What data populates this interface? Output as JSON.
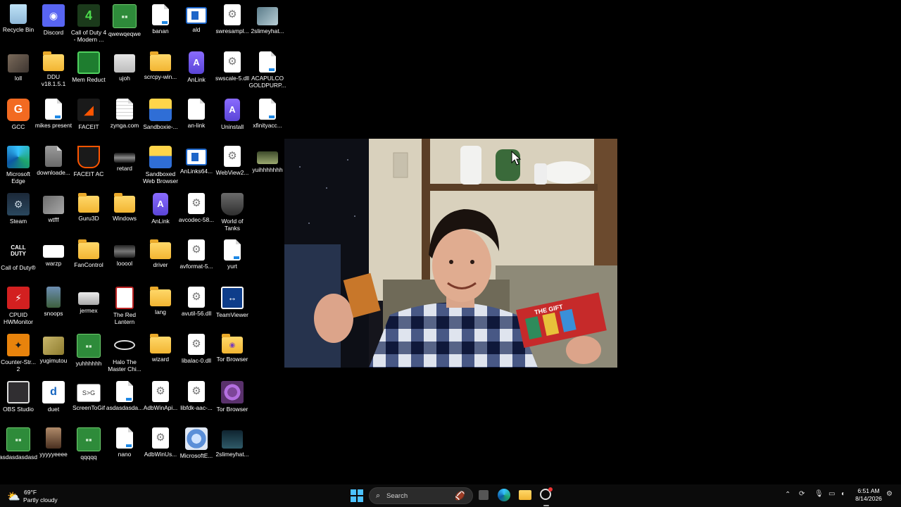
{
  "desktop": {
    "icons": [
      {
        "label": "Recycle Bin",
        "icon": "recycle-bin-icon"
      },
      {
        "label": "Discord",
        "icon": "discord-icon"
      },
      {
        "label": "Call of Duty 4 - Modern ...",
        "icon": "cod4-icon"
      },
      {
        "label": "qwewqeqwe",
        "icon": "creeper-icon"
      },
      {
        "label": "banan",
        "icon": "file-icon"
      },
      {
        "label": "ald",
        "icon": "window-file-icon"
      },
      {
        "label": "swresampl...",
        "icon": "dll-icon"
      },
      {
        "label": "2slimeyhat...",
        "icon": "image-icon"
      },
      {
        "label": "loll",
        "icon": "image-icon"
      },
      {
        "label": "DDU v18.1.5.1",
        "icon": "folder-icon"
      },
      {
        "label": "Mem Reduct",
        "icon": "mem-reduct-icon"
      },
      {
        "label": "ujoh",
        "icon": "image-icon"
      },
      {
        "label": "scrcpy-win...",
        "icon": "folder-icon"
      },
      {
        "label": "AnLink",
        "icon": "anlink-icon"
      },
      {
        "label": "swscale-5.dll",
        "icon": "dll-icon"
      },
      {
        "label": "ACAPULCO GOLDPURP...",
        "icon": "file-icon"
      },
      {
        "label": "GCC",
        "icon": "gcc-icon"
      },
      {
        "label": "mikes present",
        "icon": "file-icon"
      },
      {
        "label": "FACEIT",
        "icon": "faceit-icon"
      },
      {
        "label": "zynga.com",
        "icon": "text-file-icon"
      },
      {
        "label": "Sandboxie-...",
        "icon": "sandboxie-icon"
      },
      {
        "label": "an-link",
        "icon": "file-icon"
      },
      {
        "label": "Uninstall",
        "icon": "uninstall-icon"
      },
      {
        "label": "xfinityacc...",
        "icon": "file-icon"
      },
      {
        "label": "Microsoft Edge",
        "icon": "edge-icon"
      },
      {
        "label": "downloade...",
        "icon": "image-icon"
      },
      {
        "label": "FACEIT AC",
        "icon": "faceit-ac-icon"
      },
      {
        "label": "retard",
        "icon": "image-icon"
      },
      {
        "label": "Sandboxed Web Browser",
        "icon": "sandboxie-icon"
      },
      {
        "label": "AnLinks64...",
        "icon": "window-file-icon"
      },
      {
        "label": "WebView2...",
        "icon": "dll-icon"
      },
      {
        "label": "yuihhhhhhh",
        "icon": "image-icon"
      },
      {
        "label": "Steam",
        "icon": "steam-icon"
      },
      {
        "label": "wtfff",
        "icon": "image-icon"
      },
      {
        "label": "Guru3D",
        "icon": "folder-icon"
      },
      {
        "label": "Windows",
        "icon": "folder-icon"
      },
      {
        "label": "AnLink",
        "icon": "anlink-icon"
      },
      {
        "label": "avcodec-58...",
        "icon": "dll-icon"
      },
      {
        "label": "World of Tanks",
        "icon": "world-of-tanks-icon"
      },
      {
        "label": "Call of Duty®",
        "icon": "call-of-duty-icon"
      },
      {
        "label": "warzp",
        "icon": "file-icon"
      },
      {
        "label": "FanControl",
        "icon": "folder-icon"
      },
      {
        "label": "looool",
        "icon": "image-icon"
      },
      {
        "label": "driver",
        "icon": "folder-icon"
      },
      {
        "label": "avformat-5...",
        "icon": "dll-icon"
      },
      {
        "label": "yurt",
        "icon": "file-icon"
      },
      {
        "label": "CPUID HWMonitor",
        "icon": "hwmonitor-icon"
      },
      {
        "label": "snoops",
        "icon": "image-icon"
      },
      {
        "label": "jermex",
        "icon": "image-icon"
      },
      {
        "label": "The Red Lantern",
        "icon": "red-lantern-icon"
      },
      {
        "label": "lang",
        "icon": "folder-icon"
      },
      {
        "label": "avutil-56.dll",
        "icon": "dll-icon"
      },
      {
        "label": "TeamViewer",
        "icon": "teamviewer-icon"
      },
      {
        "label": "Counter-Str... 2",
        "icon": "counter-strike-icon"
      },
      {
        "label": "yugimutou",
        "icon": "image-icon"
      },
      {
        "label": "yuhhhhhh",
        "icon": "creeper-icon"
      },
      {
        "label": "Halo The Master Chi...",
        "icon": "halo-icon"
      },
      {
        "label": "wizard",
        "icon": "folder-icon"
      },
      {
        "label": "libalac-0.dll",
        "icon": "dll-icon"
      },
      {
        "label": "Tor Browser",
        "icon": "tor-folder-icon"
      },
      {
        "label": "OBS Studio",
        "icon": "obs-icon"
      },
      {
        "label": "duet",
        "icon": "duet-icon"
      },
      {
        "label": "ScreenToGif",
        "icon": "screentogif-icon"
      },
      {
        "label": "asdasdasda...",
        "icon": "file-icon"
      },
      {
        "label": "AdbWinApi...",
        "icon": "dll-icon"
      },
      {
        "label": "libfdk-aac-...",
        "icon": "dll-icon"
      },
      {
        "label": "Tor Browser",
        "icon": "tor-browser-icon"
      },
      {
        "label": "asdasdasdasd",
        "icon": "creeper-icon"
      },
      {
        "label": "yyyyyeeee",
        "icon": "image-icon"
      },
      {
        "label": "qqqqq",
        "icon": "creeper-icon"
      },
      {
        "label": "nano",
        "icon": "file-icon"
      },
      {
        "label": "AdbWinUs...",
        "icon": "dll-icon"
      },
      {
        "label": "MicrosoftE...",
        "icon": "installer-icon"
      },
      {
        "label": "2slimeyhat...",
        "icon": "image-icon"
      }
    ]
  },
  "photo": {
    "box_text": "THE GIFT"
  },
  "taskbar": {
    "weather_temp": "69°F",
    "weather_desc": "Partly cloudy",
    "search_placeholder": "Search",
    "time": "6:51 AM",
    "date": "8/14/2026"
  }
}
